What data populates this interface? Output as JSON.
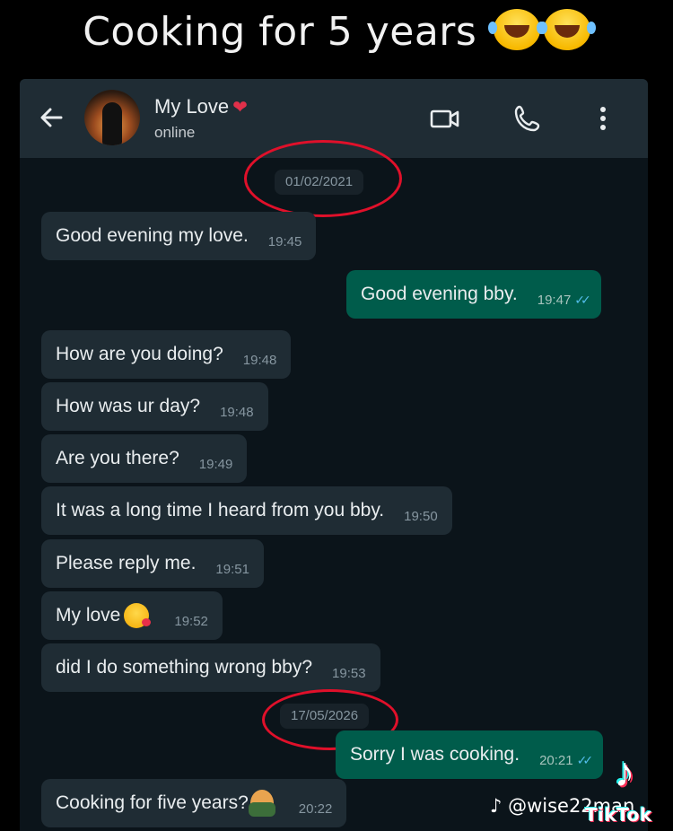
{
  "caption": {
    "text": "Cooking for 5 years",
    "emojis": [
      "face-with-tears-of-joy",
      "face-with-tears-of-joy"
    ]
  },
  "header": {
    "contact_name": "My Love",
    "heart_emoji": "❤",
    "status": "online",
    "icons": [
      "back-arrow-icon",
      "video-call-icon",
      "phone-icon",
      "more-options-icon"
    ]
  },
  "dates": [
    "01/02/2021",
    "17/05/2026"
  ],
  "messages": [
    {
      "direction": "in",
      "text": "Good evening my love.",
      "time": "19:45"
    },
    {
      "direction": "out",
      "text": "Good evening bby.",
      "time": "19:47",
      "read": true
    },
    {
      "direction": "in",
      "text": "How are you doing?",
      "time": "19:48"
    },
    {
      "direction": "in",
      "text": "How was ur day?",
      "time": "19:48"
    },
    {
      "direction": "in",
      "text": "Are you there?",
      "time": "19:49"
    },
    {
      "direction": "in",
      "text": "It was a long time I heard from you bby.",
      "time": "19:50"
    },
    {
      "direction": "in",
      "text": "Please reply me.",
      "time": "19:51"
    },
    {
      "direction": "in",
      "text": "My love",
      "emoji": "face-blowing-a-kiss",
      "time": "19:52"
    },
    {
      "direction": "in",
      "text": "did I do something wrong bby?",
      "time": "19:53"
    },
    {
      "direction": "out",
      "text": "Sorry I was cooking.",
      "time": "20:21",
      "read": true
    },
    {
      "direction": "in",
      "text": "Cooking for five years?",
      "emoji": "person-facepalming",
      "time": "20:22"
    }
  ],
  "read_ticks": "✓✓",
  "colors": {
    "annotation_ring": "#e0102a",
    "outgoing_bubble": "#005c4b",
    "incoming_bubble": "#1f2c34",
    "read_ticks": "#53bdeb"
  },
  "watermark": {
    "handle": "@wise22man",
    "brand": "TikTok"
  }
}
